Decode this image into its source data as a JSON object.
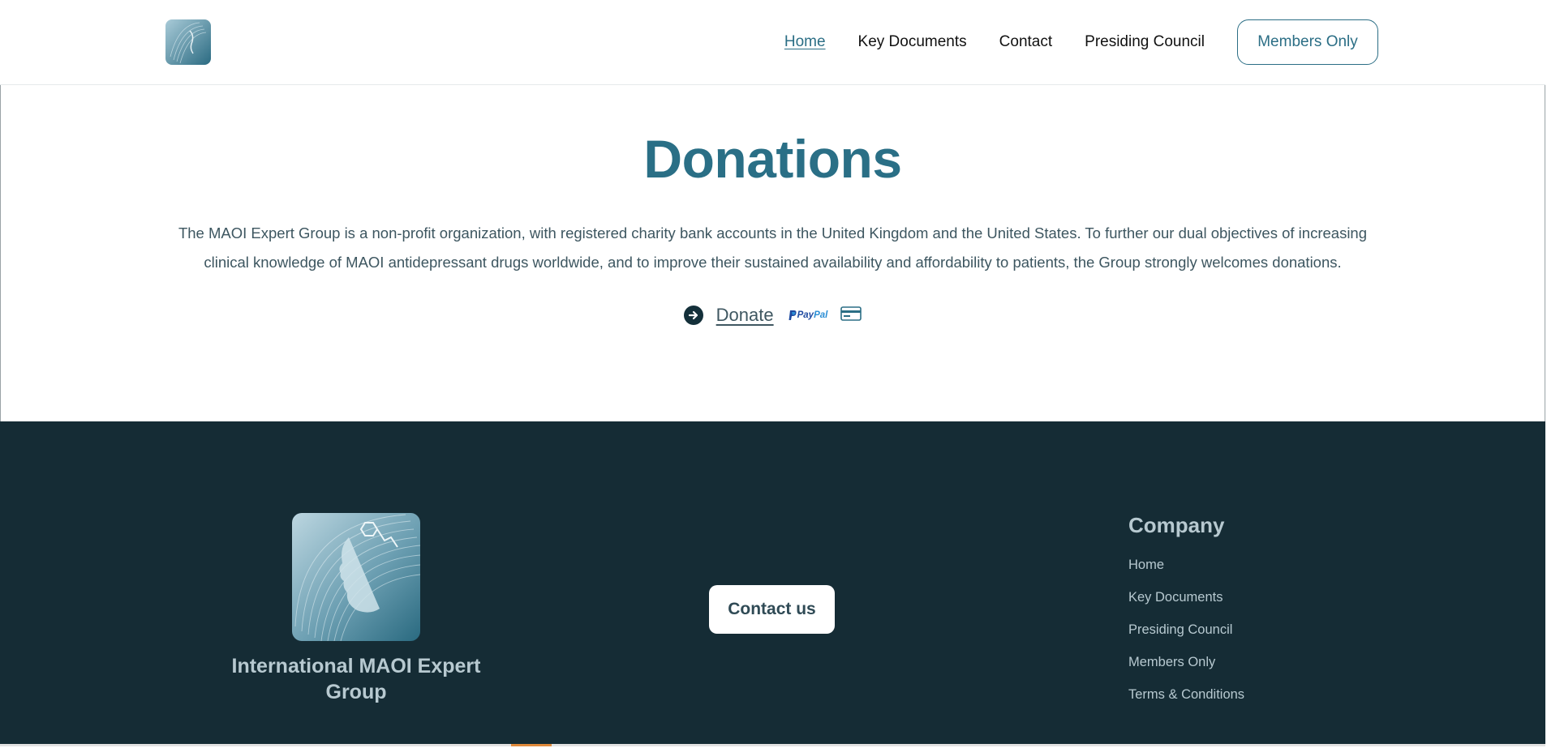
{
  "nav": {
    "items": [
      {
        "label": "Home",
        "active": true
      },
      {
        "label": "Key Documents"
      },
      {
        "label": "Contact"
      },
      {
        "label": "Presiding Council"
      }
    ],
    "members_label": "Members Only"
  },
  "main": {
    "title": "Donations",
    "description": "The MAOI Expert Group is a non-profit organization, with registered charity bank accounts in the United Kingdom and the United States. To further our dual objectives of increasing clinical knowledge of MAOI antidepressant drugs worldwide, and to improve their sustained availability and affordability to patients, the Group strongly welcomes donations.",
    "donate_label": "Donate",
    "paypal_text_1": "Pay",
    "paypal_text_2": "Pal"
  },
  "footer": {
    "org_name": "International MAOI Expert Group",
    "contact_label": "Contact us",
    "company_title": "Company",
    "links": [
      "Home",
      "Key Documents",
      "Presiding Council",
      "Members Only",
      "Terms & Conditions"
    ]
  },
  "colors": {
    "accent": "#2a6f86",
    "footer_bg": "#152c35",
    "footer_text": "#b7c9d0"
  },
  "icons": [
    "arrow-right-circle-icon",
    "paypal-icon",
    "credit-card-icon"
  ]
}
